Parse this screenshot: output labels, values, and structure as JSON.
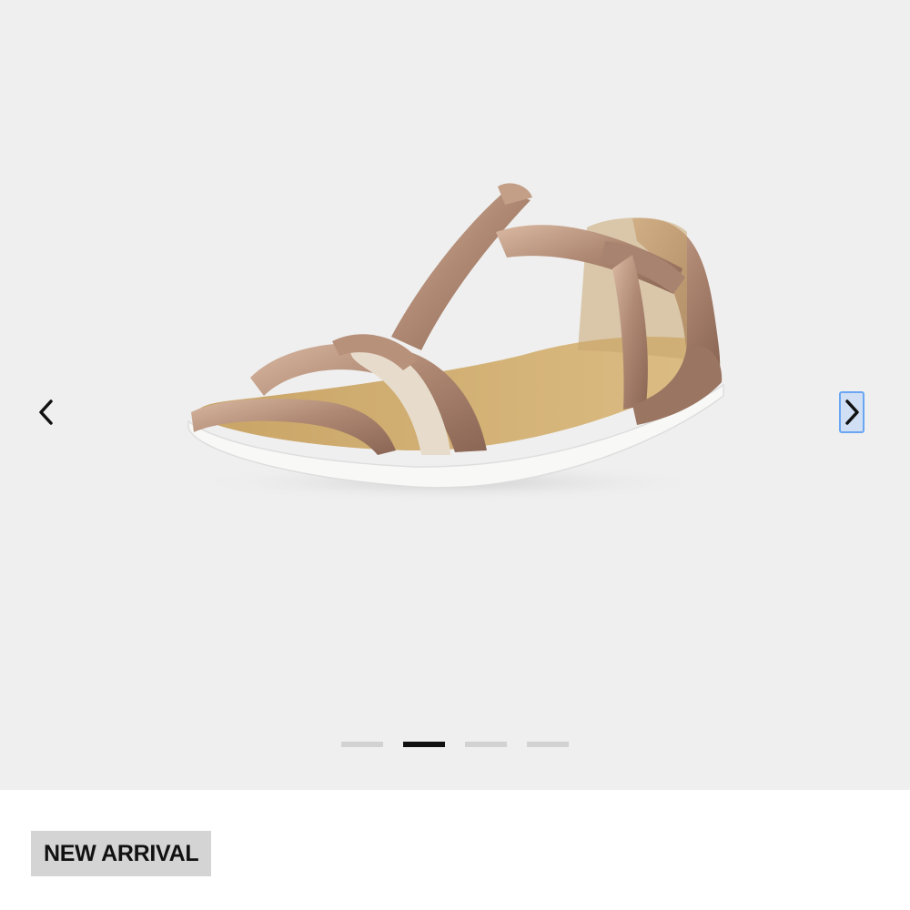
{
  "gallery": {
    "prev_icon": "chevron-left-icon",
    "next_icon": "chevron-right-icon",
    "dot_count": 4,
    "active_slide": 2
  },
  "badge": {
    "label": "NEW ARRIVAL"
  },
  "colors": {
    "gallery_bg": "#efefef",
    "badge_bg": "#d4d4d4",
    "active_dot": "#111111",
    "inactive_dot": "#d2d2d2",
    "focus_outline": "#6aa6f2"
  }
}
